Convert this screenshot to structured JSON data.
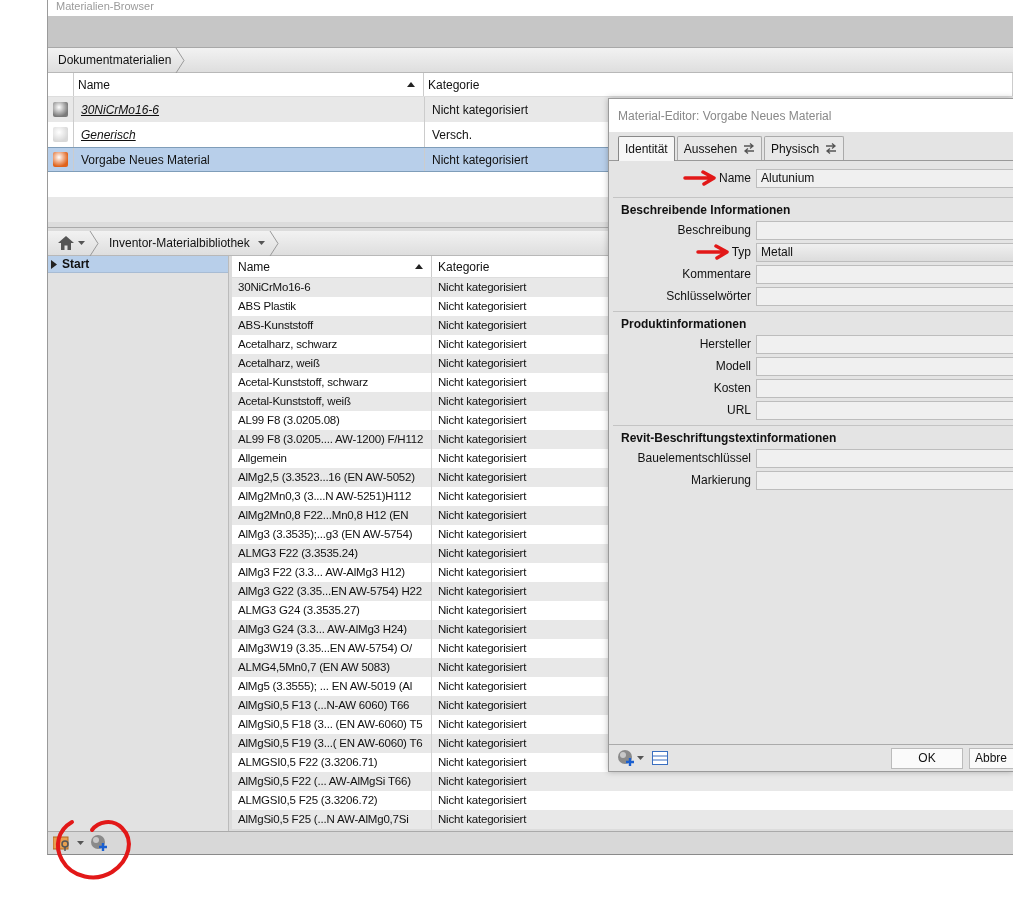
{
  "browser": {
    "title": "Materialien-Browser"
  },
  "document_materials": {
    "breadcrumb": "Dokumentmaterialien",
    "columns": [
      {
        "label": "Name",
        "sorted": true
      },
      {
        "label": "Kategorie"
      }
    ],
    "rows": [
      {
        "name": "30NiCrMo16-6",
        "category": "Nicht kategorisiert",
        "color": "#7a7a7a",
        "linked": true,
        "selected": false
      },
      {
        "name": "Generisch",
        "category": "Versch.",
        "color": "#d8d8d8",
        "linked": true,
        "selected": false
      },
      {
        "name": "Vorgabe Neues Material",
        "category": "Nicht kategorisiert",
        "color": "#e0621a",
        "linked": false,
        "selected": true
      }
    ]
  },
  "library": {
    "breadcrumb": "Inventor-Materialbibliothek",
    "tree": [
      {
        "label": "Start",
        "selected": true,
        "expanded": false
      }
    ],
    "columns": [
      {
        "label": "Name",
        "sorted": true
      },
      {
        "label": "Kategorie"
      }
    ],
    "rows": [
      {
        "name": "30NiCrMo16-6",
        "category": "Nicht kategorisiert"
      },
      {
        "name": "ABS Plastik",
        "category": "Nicht kategorisiert"
      },
      {
        "name": "ABS-Kunststoff",
        "category": "Nicht kategorisiert"
      },
      {
        "name": "Acetalharz, schwarz",
        "category": "Nicht kategorisiert"
      },
      {
        "name": "Acetalharz, weiß",
        "category": "Nicht kategorisiert"
      },
      {
        "name": "Acetal-Kunststoff, schwarz",
        "category": "Nicht kategorisiert"
      },
      {
        "name": "Acetal-Kunststoff, weiß",
        "category": "Nicht kategorisiert"
      },
      {
        "name": "AL99 F8 (3.0205.08)",
        "category": "Nicht kategorisiert"
      },
      {
        "name": "AL99 F8 (3.0205.... AW-1200) F/H112",
        "category": "Nicht kategorisiert"
      },
      {
        "name": "Allgemein",
        "category": "Nicht kategorisiert"
      },
      {
        "name": "AlMg2,5 (3.3523...16 (EN AW-5052)",
        "category": "Nicht kategorisiert"
      },
      {
        "name": "AlMg2Mn0,3 (3....N AW-5251)H112",
        "category": "Nicht kategorisiert"
      },
      {
        "name": "AlMg2Mn0,8 F22...Mn0,8 H12 (EN",
        "category": "Nicht kategorisiert"
      },
      {
        "name": "AlMg3 (3.3535);...g3 (EN AW-5754)",
        "category": "Nicht kategorisiert"
      },
      {
        "name": "ALMG3 F22 (3.3535.24)",
        "category": "Nicht kategorisiert"
      },
      {
        "name": "AlMg3 F22 (3.3... AW-AlMg3 H12)",
        "category": "Nicht kategorisiert"
      },
      {
        "name": "AlMg3 G22 (3.35...EN AW-5754) H22",
        "category": "Nicht kategorisiert"
      },
      {
        "name": "ALMG3 G24 (3.3535.27)",
        "category": "Nicht kategorisiert"
      },
      {
        "name": "AlMg3 G24 (3.3... AW-AlMg3 H24)",
        "category": "Nicht kategorisiert"
      },
      {
        "name": "AlMg3W19 (3.35...EN AW-5754) O/",
        "category": "Nicht kategorisiert"
      },
      {
        "name": "ALMG4,5Mn0,7 (EN AW 5083)",
        "category": "Nicht kategorisiert"
      },
      {
        "name": "AlMg5 (3.3555); ... EN AW-5019 (Al",
        "category": "Nicht kategorisiert"
      },
      {
        "name": "AlMgSi0,5 F13 (...N-AW 6060)  T66",
        "category": "Nicht kategorisiert"
      },
      {
        "name": "AlMgSi0,5 F18 (3... (EN AW-6060) T5",
        "category": "Nicht kategorisiert"
      },
      {
        "name": "AlMgSi0,5 F19 (3...( EN AW-6060) T6",
        "category": "Nicht kategorisiert"
      },
      {
        "name": "ALMGSI0,5 F22 (3.3206.71)",
        "category": "Nicht kategorisiert"
      },
      {
        "name": "AlMgSi0,5 F22 (... AW-AlMgSi T66)",
        "category": "Nicht kategorisiert"
      },
      {
        "name": "ALMGSI0,5 F25 (3.3206.72)",
        "category": "Nicht kategorisiert"
      },
      {
        "name": "AlMgSi0,5 F25 (...N AW-AlMg0,7Si",
        "category": "Nicht kategorisiert"
      }
    ]
  },
  "editor": {
    "title": "Material-Editor: Vorgabe Neues Material",
    "tabs": [
      {
        "label": "Identität",
        "selected": true,
        "swap": false
      },
      {
        "label": "Aussehen",
        "selected": false,
        "swap": true
      },
      {
        "label": "Physisch",
        "selected": false,
        "swap": true
      }
    ],
    "name_field": {
      "label": "Name",
      "value": "Alutunium",
      "annotated": true
    },
    "sections": [
      {
        "title": "Beschreibende Informationen",
        "fields": [
          {
            "label": "Beschreibung",
            "kind": "text",
            "annotated": false
          },
          {
            "label": "Typ",
            "kind": "dropdown",
            "value": "Metall",
            "annotated": true
          },
          {
            "label": "Kommentare",
            "kind": "text",
            "annotated": false
          },
          {
            "label": "Schlüsselwörter",
            "kind": "text",
            "annotated": false
          }
        ]
      },
      {
        "title": "Produktinformationen",
        "fields": [
          {
            "label": "Hersteller",
            "kind": "text",
            "annotated": false
          },
          {
            "label": "Modell",
            "kind": "text",
            "annotated": false
          },
          {
            "label": "Kosten",
            "kind": "text",
            "annotated": false
          },
          {
            "label": "URL",
            "kind": "text",
            "annotated": false
          }
        ]
      },
      {
        "title": "Revit-Beschriftungstextinformationen",
        "fields": [
          {
            "label": "Bauelementschlüssel",
            "kind": "text",
            "annotated": false
          },
          {
            "label": "Markierung",
            "kind": "text",
            "annotated": false
          }
        ]
      }
    ],
    "buttons": [
      "OK",
      "Abbre"
    ]
  }
}
